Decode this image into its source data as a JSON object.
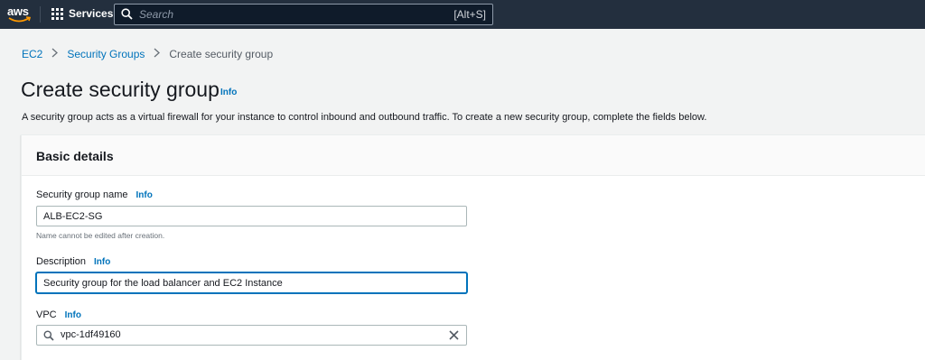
{
  "topnav": {
    "logo_text": "aws",
    "services_label": "Services",
    "search_placeholder": "Search",
    "search_shortcut": "[Alt+S]",
    "bg_color": "#232f3e"
  },
  "breadcrumb": {
    "items": [
      "EC2",
      "Security Groups"
    ],
    "current": "Create security group"
  },
  "page": {
    "title": "Create security group",
    "title_info": "Info",
    "description": "A security group acts as a virtual firewall for your instance to control inbound and outbound traffic. To create a new security group, complete the fields below."
  },
  "basic_details": {
    "heading": "Basic details",
    "name_label": "Security group name",
    "name_info": "Info",
    "name_value": "ALB-EC2-SG",
    "name_hint": "Name cannot be edited after creation.",
    "description_label": "Description",
    "description_info": "Info",
    "description_value": "Security group for the load balancer and EC2 Instance",
    "vpc_label": "VPC",
    "vpc_info": "Info",
    "vpc_value": "vpc-1df49160"
  },
  "colors": {
    "link": "#0073bb",
    "focus": "#0073bb",
    "page_bg": "#f2f3f3"
  },
  "icons": [
    "grid-icon",
    "search-icon",
    "chevron-right-icon",
    "close-icon"
  ]
}
